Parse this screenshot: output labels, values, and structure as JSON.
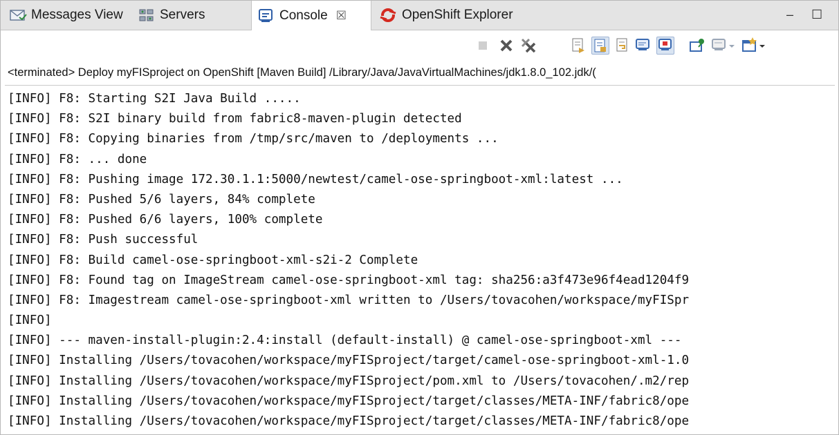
{
  "tabs": [
    {
      "label": "Messages View",
      "icon": "messages-icon"
    },
    {
      "label": "Servers",
      "icon": "servers-icon"
    },
    {
      "label": "Console",
      "icon": "console-icon",
      "active": true,
      "close": "☒"
    },
    {
      "label": "OpenShift Explorer",
      "icon": "openshift-icon"
    }
  ],
  "window_controls": {
    "minimize": "‒",
    "maximize": "☐"
  },
  "toolbar": {
    "buttons": [
      "terminate",
      "remove-launch",
      "remove-all-terminated",
      "clear-console",
      "scroll-lock",
      "word-wrap",
      "show-console-stdout",
      "show-console-stderr",
      "pin-console",
      "display-selected-console",
      "open-console"
    ]
  },
  "status_text": "<terminated> Deploy myFISproject on OpenShift [Maven Build] /Library/Java/JavaVirtualMachines/jdk1.8.0_102.jdk/(",
  "console_lines": [
    "[INFO] F8: Starting S2I Java Build .....",
    "[INFO] F8: S2I binary build from fabric8-maven-plugin detected",
    "[INFO] F8: Copying binaries from /tmp/src/maven to /deployments ...",
    "[INFO] F8: ... done",
    "[INFO] F8: Pushing image 172.30.1.1:5000/newtest/camel-ose-springboot-xml:latest ...",
    "[INFO] F8: Pushed 5/6 layers, 84% complete",
    "[INFO] F8: Pushed 6/6 layers, 100% complete",
    "[INFO] F8: Push successful",
    "[INFO] F8: Build camel-ose-springboot-xml-s2i-2 Complete",
    "[INFO] F8: Found tag on ImageStream camel-ose-springboot-xml tag: sha256:a3f473e96f4ead1204f9",
    "[INFO] F8: Imagestream camel-ose-springboot-xml written to /Users/tovacohen/workspace/myFISpr",
    "[INFO]",
    "[INFO] --- maven-install-plugin:2.4:install (default-install) @ camel-ose-springboot-xml ---",
    "[INFO] Installing /Users/tovacohen/workspace/myFISproject/target/camel-ose-springboot-xml-1.0",
    "[INFO] Installing /Users/tovacohen/workspace/myFISproject/pom.xml to /Users/tovacohen/.m2/rep",
    "[INFO] Installing /Users/tovacohen/workspace/myFISproject/target/classes/META-INF/fabric8/ope",
    "[INFO] Installing /Users/tovacohen/workspace/myFISproject/target/classes/META-INF/fabric8/ope"
  ]
}
